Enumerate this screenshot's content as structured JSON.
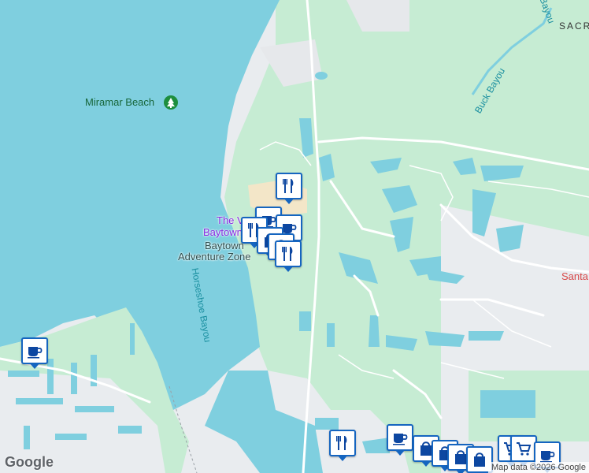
{
  "map": {
    "labels": {
      "miramar_beach": "Miramar Beach",
      "buck_bayou": "Buck Bayou",
      "bayou_top": "Bayou",
      "sacr": "SACR",
      "village_the": "The V",
      "village_baytown": "Baytown",
      "adventure_line1": "Baytown",
      "adventure_line2": "Adventure Zone",
      "horseshoe_bayou": "Horseshoe Bayou",
      "santa": "Santa"
    },
    "colors": {
      "water": "#7fcfdf",
      "land": "#e9ecef",
      "park": "#c6ecd3",
      "marker_border": "#1565c0",
      "road": "#ffffff"
    },
    "markers": [
      {
        "name": "restaurant-marker",
        "icon": "fork-knife-icon"
      },
      {
        "name": "cafe-marker",
        "icon": "coffee-cup-icon"
      },
      {
        "name": "shopping-marker",
        "icon": "shopping-bag-icon"
      },
      {
        "name": "grocery-marker",
        "icon": "shopping-cart-icon"
      }
    ],
    "logo": "Google",
    "attribution": "Map data ©2026 Google"
  }
}
